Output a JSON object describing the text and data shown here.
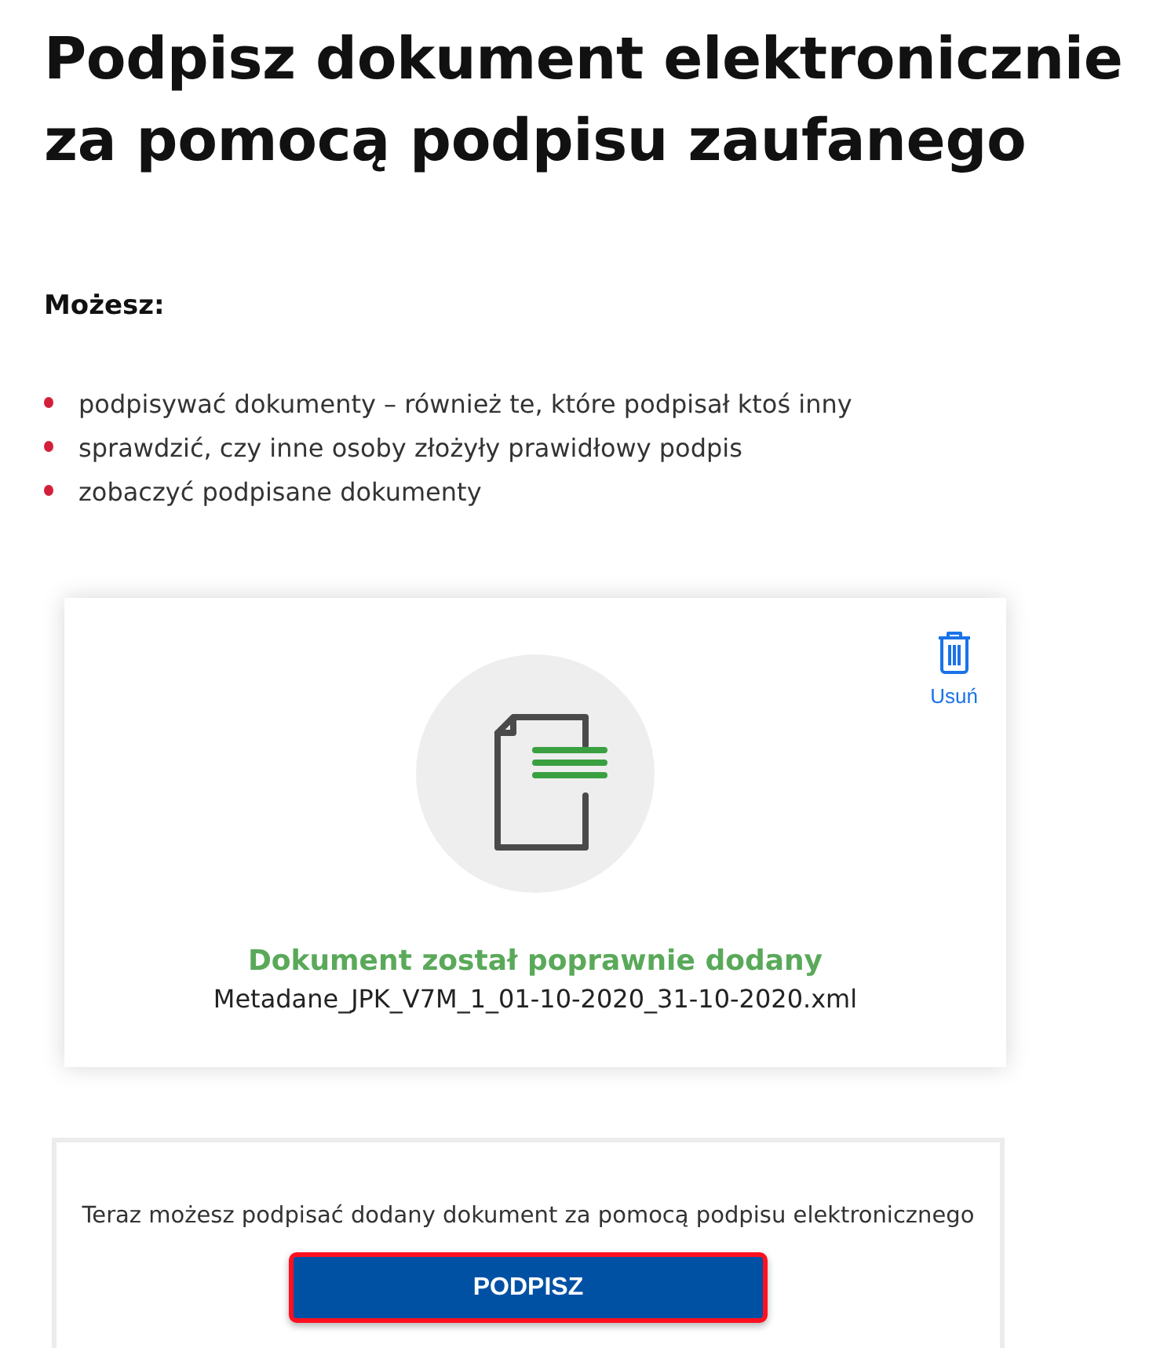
{
  "title": "Podpisz dokument elektronicznie za pomocą podpisu zaufanego",
  "intro": {
    "label": "Możesz:",
    "items": [
      "podpisywać dokumenty – również te, które podpisał ktoś inny",
      "sprawdzić, czy inne osoby złożyły prawidłowy podpis",
      "zobaczyć podpisane dokumenty"
    ]
  },
  "upload_card": {
    "delete_label": "Usuń",
    "status": "Dokument został poprawnie dodany",
    "file_name": "Metadane_JPK_V7M_1_01-10-2020_31-10-2020.xml"
  },
  "sign_card": {
    "prompt": "Teraz możesz podpisać dodany dokument za pomocą podpisu elektronicznego",
    "button": "PODPISZ"
  }
}
